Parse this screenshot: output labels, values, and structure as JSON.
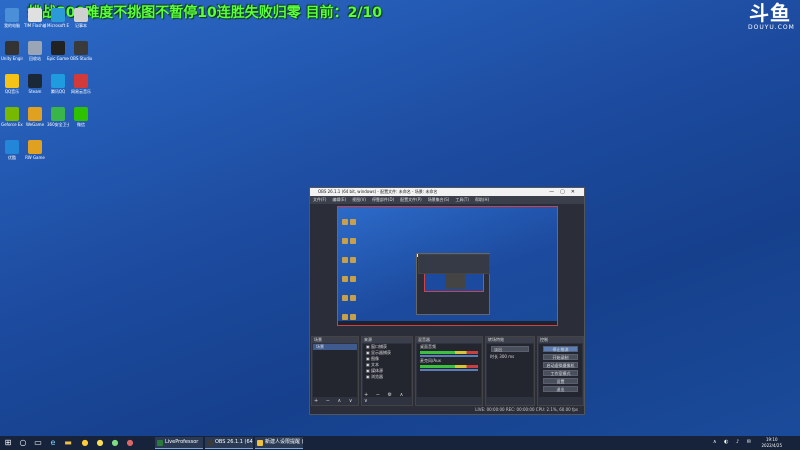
{
  "stream": {
    "banner_prefix": "挑战",
    "banner_num": "800",
    "banner_mid": "难度不挑图不暂停",
    "banner_num2": "10",
    "banner_suffix": "连胜失败归零  目前：",
    "banner_progress": "2/10"
  },
  "brand": {
    "logo_text": "斗鱼",
    "domain_text": "DOUYU.COM"
  },
  "desktop_icons": [
    {
      "label": "我的电脑",
      "color": "#4a8fd8"
    },
    {
      "label": "TIM Flash编辑",
      "color": "#e0e0e0"
    },
    {
      "label": "Microsoft Edge",
      "color": "#2c9ad8"
    },
    {
      "label": "记事本",
      "color": "#d0d0d0"
    },
    {
      "label": "Unity Engine",
      "color": "#333333"
    },
    {
      "label": "回收站",
      "color": "#9aa6b5"
    },
    {
      "label": "Epic Games Launcher",
      "color": "#222222"
    },
    {
      "label": "OBS Studio",
      "color": "#3a3a3a"
    },
    {
      "label": "QQ音乐",
      "color": "#f5c318"
    },
    {
      "label": "Steam",
      "color": "#1b2838"
    },
    {
      "label": "腾讯QQ",
      "color": "#1f9be0"
    },
    {
      "label": "网易云音乐",
      "color": "#d23a3a"
    },
    {
      "label": "Geforce Experience",
      "color": "#76b900"
    },
    {
      "label": "WeGame",
      "color": "#e0a020"
    },
    {
      "label": "360安全卫士",
      "color": "#39b54a"
    },
    {
      "label": "微信",
      "color": "#2dc100"
    },
    {
      "label": "优酷",
      "color": "#2486d8"
    },
    {
      "label": "RW Game",
      "color": "#e0a020"
    }
  ],
  "obs": {
    "title": "OBS 26.1.1 (64 bit, windows) - 配置文件: 未命名 - 场景: 未命名",
    "menu": [
      "文件(F)",
      "编辑(E)",
      "视图(V)",
      "停靠部件(D)",
      "配置文件(P)",
      "场景集合(S)",
      "工具(T)",
      "帮助(H)"
    ],
    "scenes_title": "场景",
    "scenes": [
      "场景"
    ],
    "sources_title": "来源",
    "sources": [
      "窗口捕获",
      "显示器捕获",
      "图像",
      "文本",
      "媒体源",
      "浏览器"
    ],
    "mixer_title": "混音器",
    "mixer_tracks": [
      "桌面音频",
      "麦克风/Aux"
    ],
    "transition_title": "转场特效",
    "transition_value": "淡出",
    "duration_label": "时长",
    "duration_value": "300 ms",
    "controls_title": "控制",
    "controls": [
      "停止推流",
      "开始录制",
      "启动虚拟摄像机",
      "工作室模式",
      "设置",
      "退出"
    ],
    "status_text": "LIVE: 00:00:00  REC: 00:00:00  CPU: 2.1%, 60.00 fps"
  },
  "taskbar": {
    "apps": [
      {
        "label": "LiveProfessor",
        "color": "#2a7a3a"
      },
      {
        "label": "OBS 26.1.1 (64 bit...",
        "color": "#3a3a3a"
      },
      {
        "label": "新建人设限提醒 (2)...",
        "color": "#f0c040"
      }
    ],
    "time": "19:10",
    "date": "2022/4/25"
  }
}
